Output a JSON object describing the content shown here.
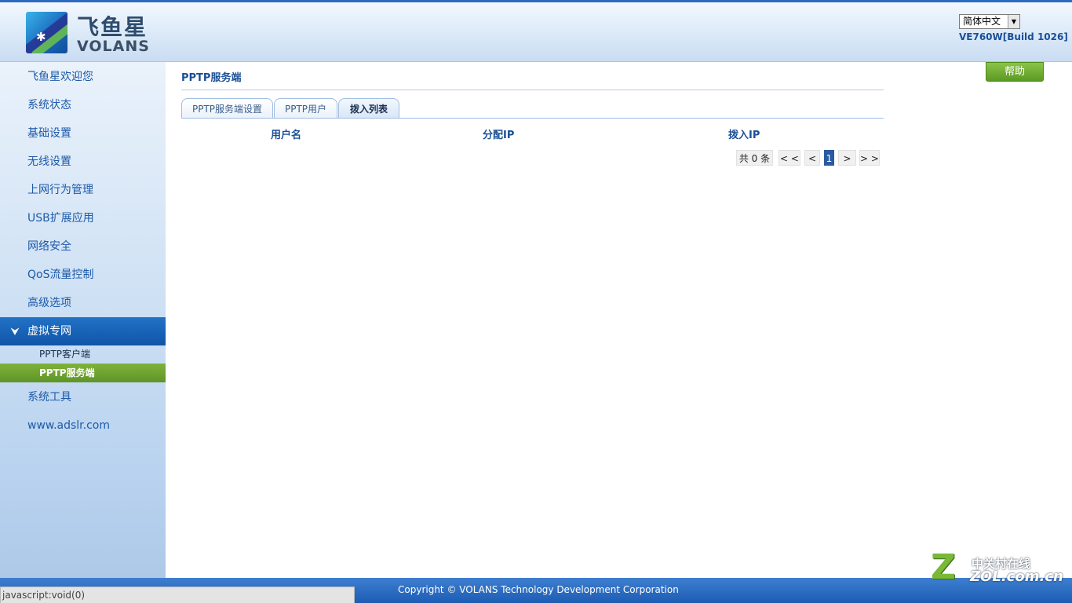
{
  "header": {
    "logo_cn": "飞鱼星",
    "logo_en": "VOLANS",
    "language": "简体中文",
    "version": "VE760W[Build 1026]"
  },
  "sidebar": {
    "items": [
      {
        "label": "飞鱼星欢迎您"
      },
      {
        "label": "系统状态"
      },
      {
        "label": "基础设置"
      },
      {
        "label": "无线设置"
      },
      {
        "label": "上网行为管理"
      },
      {
        "label": "USB扩展应用"
      },
      {
        "label": "网络安全"
      },
      {
        "label": "QoS流量控制"
      },
      {
        "label": "高级选项"
      },
      {
        "label": "虚拟专网"
      },
      {
        "label": "系统工具"
      },
      {
        "label": "www.adslr.com"
      }
    ],
    "subitems": [
      {
        "label": "PPTP客户端"
      },
      {
        "label": "PPTP服务端"
      }
    ]
  },
  "main": {
    "title": "PPTP服务端",
    "help_label": "帮助",
    "tabs": [
      {
        "label": "PPTP服务端设置"
      },
      {
        "label": "PPTP用户"
      },
      {
        "label": "拨入列表"
      }
    ],
    "table": {
      "columns": [
        "用户名",
        "分配IP",
        "拨入IP"
      ]
    },
    "pager": {
      "count_label": "共 0 条",
      "first": "< <",
      "prev": "<",
      "current": "1",
      "next": ">",
      "last": "> >"
    }
  },
  "footer": {
    "copyright": "Copyright © VOLANS Technology Development Corporation",
    "status_text": "javascript:void(0)",
    "watermark_cn": "中关村在线",
    "watermark_en": "ZOL.com.cn",
    "watermark_letter": "Z"
  },
  "colors": {
    "accent_blue": "#1d5aa8",
    "active_nav": "#0f55a8",
    "active_sub": "#6fa32f",
    "help_green": "#5a9a22"
  }
}
